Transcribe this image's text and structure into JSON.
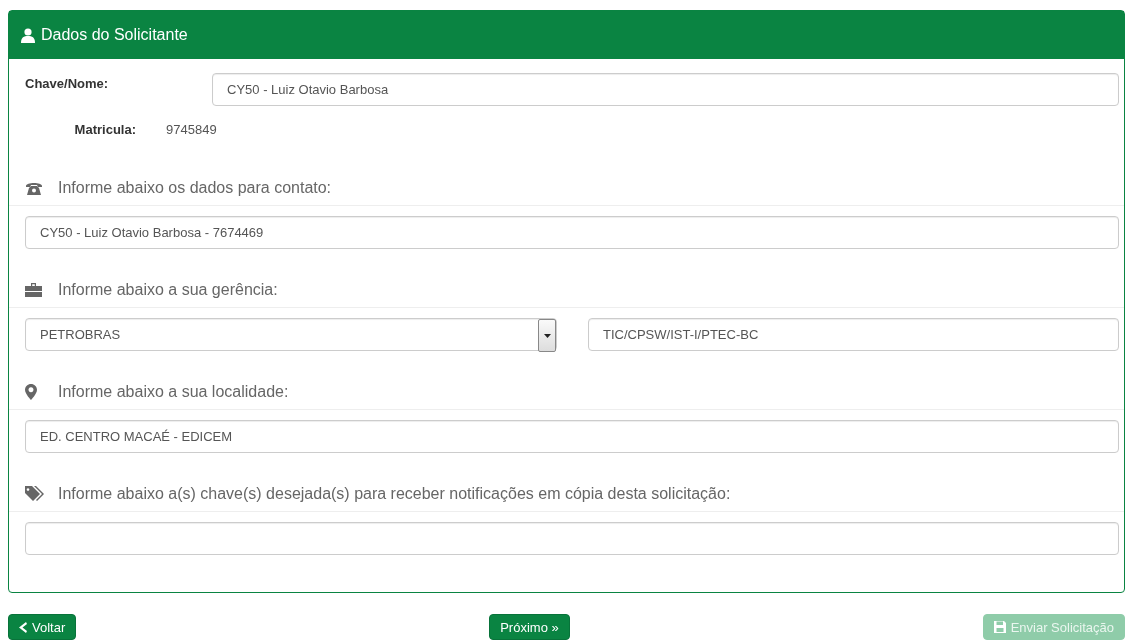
{
  "panel": {
    "title": "Dados do Solicitante",
    "name_field": {
      "label": "Chave/Nome:",
      "value": "CY50 - Luiz Otavio Barbosa"
    },
    "registration": {
      "label": "Matricula:",
      "value": "9745849"
    },
    "sections": [
      {
        "kind": "contact",
        "heading": "Informe abaixo os dados para contato:",
        "inputs": [
          {
            "kind": "text",
            "value": "CY50 - Luiz Otavio Barbosa - 7674469"
          }
        ]
      },
      {
        "kind": "management",
        "heading": "Informe abaixo a sua gerência:",
        "inputs": [
          {
            "kind": "select",
            "value": "PETROBRAS"
          },
          {
            "kind": "text",
            "value": "TIC/CPSW/IST-I/PTEC-BC"
          }
        ]
      },
      {
        "kind": "location",
        "heading": "Informe abaixo a sua localidade:",
        "inputs": [
          {
            "kind": "text",
            "value": "ED. CENTRO MACAÉ - EDICEM"
          }
        ]
      },
      {
        "kind": "copy",
        "heading": "Informe abaixo a(s) chave(s) desejada(s) para receber notificações em cópia desta solicitação:",
        "inputs": [
          {
            "kind": "text"
          }
        ]
      }
    ]
  },
  "buttons": [
    {
      "kind": "back",
      "label": "Voltar",
      "disabled": false
    },
    {
      "kind": "next",
      "label": "Próximo »",
      "disabled": false
    },
    {
      "kind": "submit",
      "label": "Enviar Solicitação",
      "disabled": true
    }
  ]
}
